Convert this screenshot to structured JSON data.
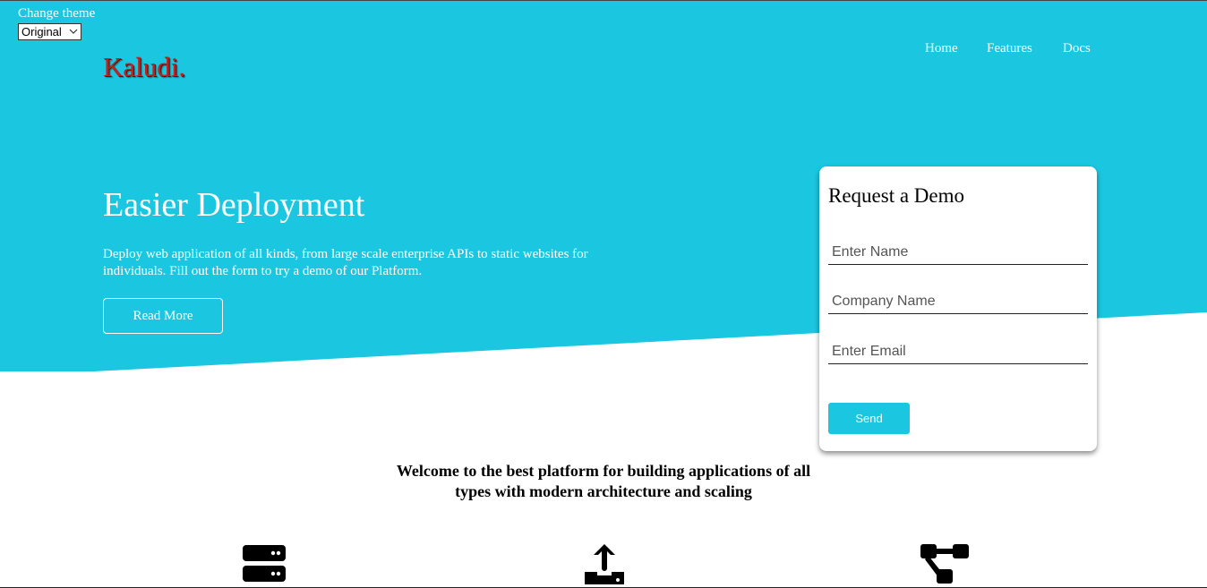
{
  "theme": {
    "label": "Change theme",
    "selected": "Original"
  },
  "brand": {
    "name": "Kaludi."
  },
  "nav": {
    "items": [
      {
        "label": "Home"
      },
      {
        "label": "Features"
      },
      {
        "label": "Docs"
      }
    ]
  },
  "hero": {
    "title": "Easier Deployment",
    "text": "Deploy web application of all kinds, from large scale enterprise APIs to static websites for individuals. Fill out the form to try a demo of our Platform.",
    "read_more_label": "Read More"
  },
  "demo_form": {
    "title": "Request a Demo",
    "name_placeholder": "Enter Name",
    "company_placeholder": "Company Name",
    "email_placeholder": "Enter Email",
    "send_label": "Send"
  },
  "welcome": {
    "text": "Welcome to the best platform for building applications of all types with modern architecture and scaling"
  },
  "features": {
    "icons": [
      "server-icon",
      "upload-icon",
      "network-icon"
    ]
  },
  "colors": {
    "hero_background": "#1bc6e0",
    "logo": "#c0231e",
    "send_button": "#1bc6e0"
  }
}
